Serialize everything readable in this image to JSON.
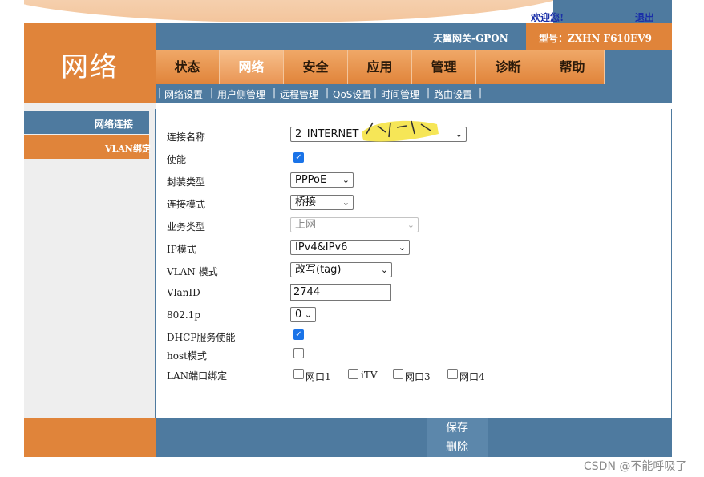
{
  "header": {
    "welcome": "欢迎您!",
    "logout": "退出",
    "logo": "网络",
    "gateway_name": "天翼网关-GPON",
    "model": "型号：ZXHN F610EV9"
  },
  "tabs": [
    "状态",
    "网络",
    "安全",
    "应用",
    "管理",
    "诊断",
    "帮助"
  ],
  "active_tab": "网络",
  "subnav": [
    "网络设置",
    "用户侧管理",
    "远程管理",
    "QoS设置",
    "时间管理",
    "路由设置"
  ],
  "active_subnav": "网络设置",
  "sidebar": {
    "items": [
      "网络连接",
      "VLAN绑定"
    ]
  },
  "form": {
    "connection_name_label": "连接名称",
    "connection_name_value": "2_INTERNET_",
    "enable_label": "使能",
    "enable_checked": true,
    "encap_label": "封装类型",
    "encap_value": "PPPoE",
    "conn_mode_label": "连接模式",
    "conn_mode_value": "桥接",
    "service_label": "业务类型",
    "service_value": "上网",
    "ip_mode_label": "IP模式",
    "ip_mode_value": "IPv4&IPv6",
    "vlan_mode_label": "VLAN 模式",
    "vlan_mode_value": "改写(tag)",
    "vlanid_label": "VlanID",
    "vlanid_value": "2744",
    "dot1p_label": "802.1p",
    "dot1p_value": "0",
    "dhcp_label": "DHCP服务使能",
    "dhcp_checked": true,
    "host_label": "host模式",
    "host_checked": false,
    "lan_bind_label": "LAN端口绑定",
    "ports": [
      "网口1",
      "iTV",
      "网口3",
      "网口4"
    ]
  },
  "buttons": {
    "save": "保存",
    "delete": "删除"
  },
  "watermark": "CSDN @不能呼吸了",
  "colors": {
    "orange": "#e0843a",
    "blue": "#4e7a9f",
    "checkbox_blue": "#1a73e8"
  }
}
